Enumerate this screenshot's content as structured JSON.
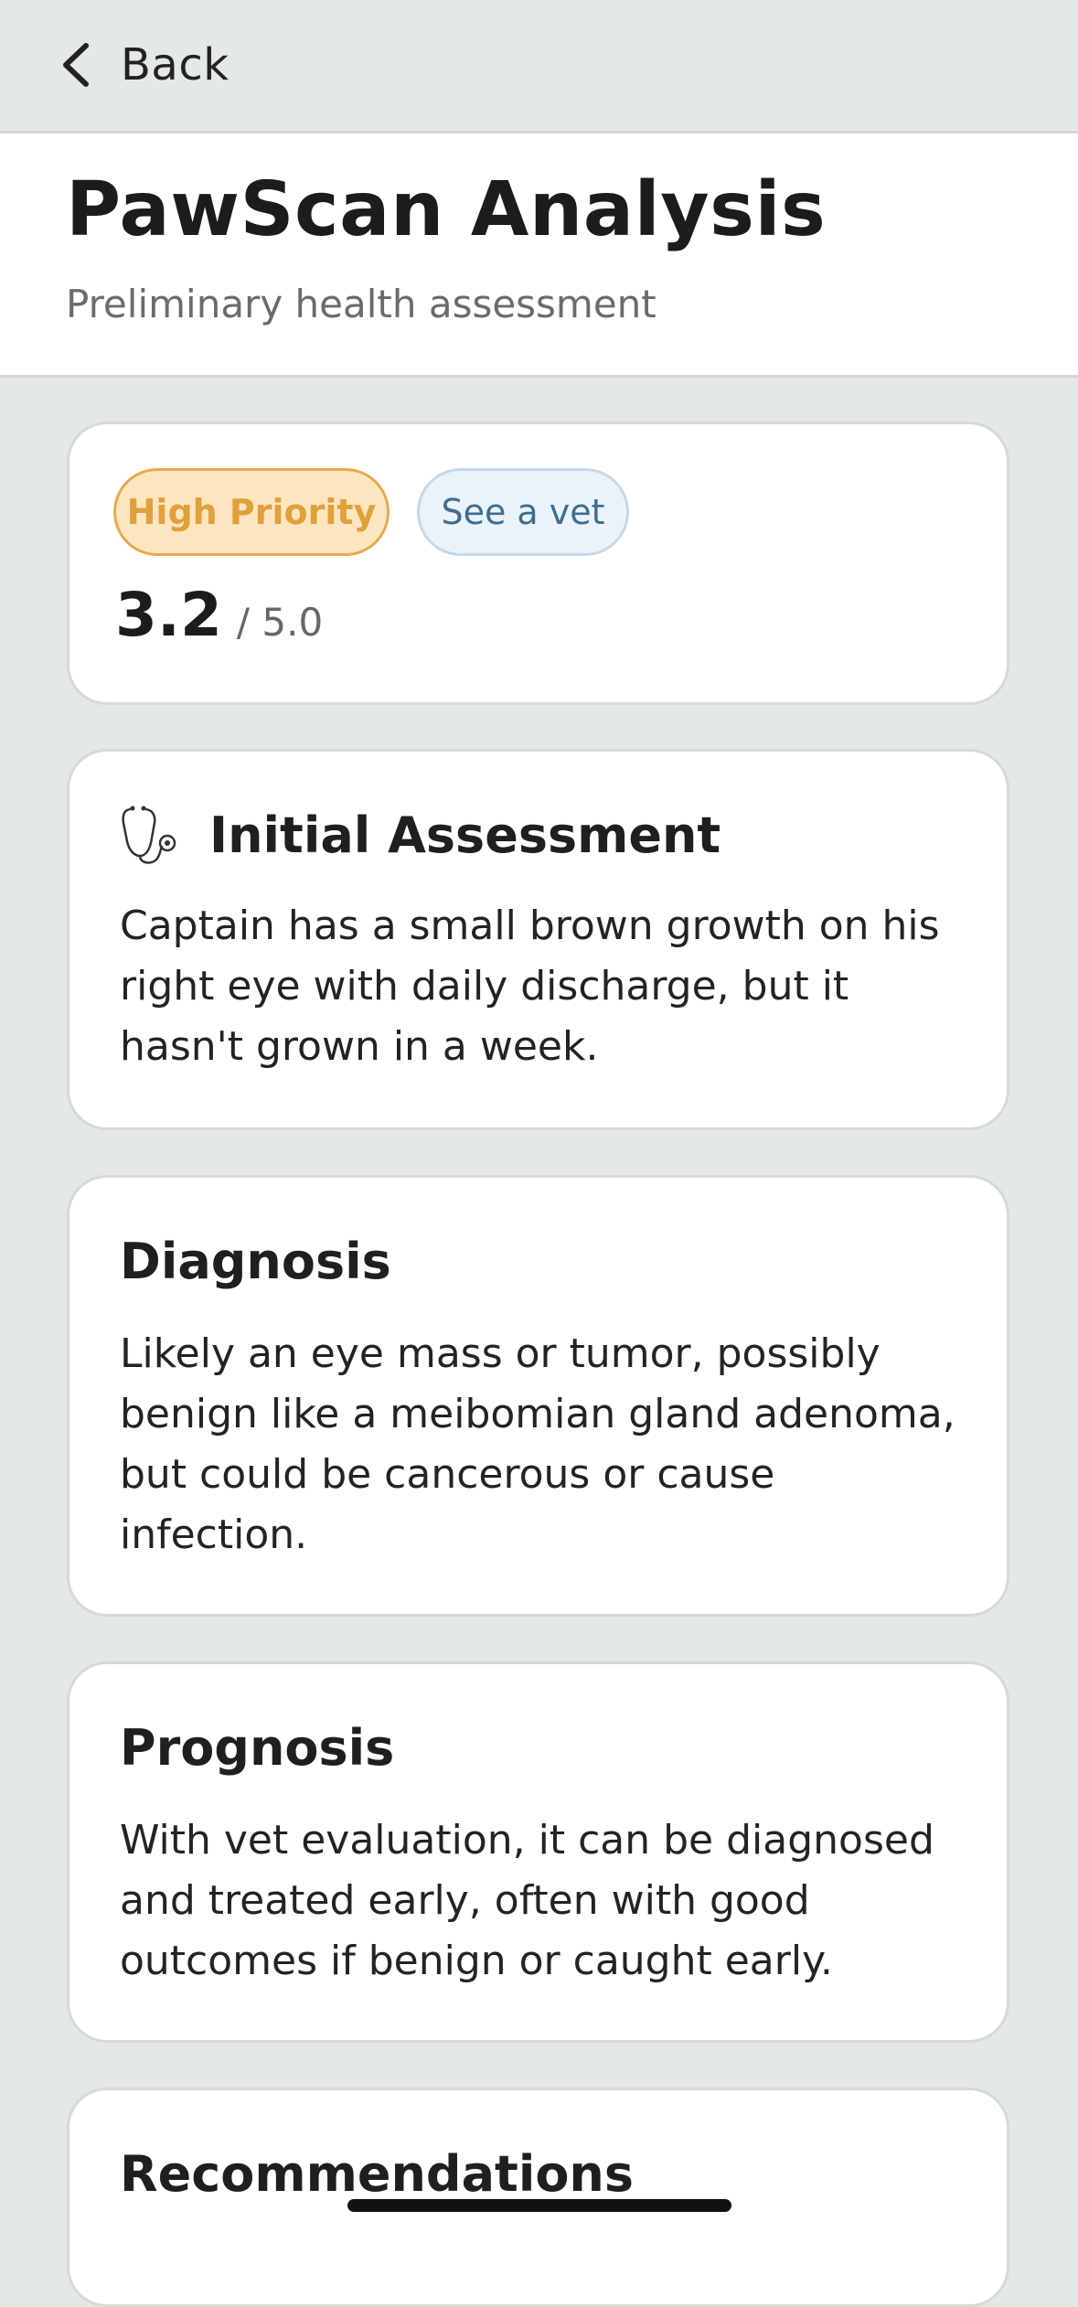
{
  "nav": {
    "back_label": "Back",
    "back_icon": "chevron-left-icon"
  },
  "header": {
    "title": "PawScan Analysis",
    "subtitle": "Preliminary health assessment"
  },
  "summary": {
    "priority_label": "High Priority",
    "action_label": "See a vet",
    "score_value": "3.2",
    "score_max": "/ 5.0",
    "priority_color": "#e0a03a"
  },
  "sections": {
    "initial": {
      "icon": "stethoscope-icon",
      "title": "Initial Assessment",
      "body": "Captain has a small brown growth on his right eye with daily discharge, but it hasn't grown in a week."
    },
    "diagnosis": {
      "title": "Diagnosis",
      "body": "Likely an eye mass or tumor, possibly benign like a meibomian gland adenoma, but could be cancerous or cause infection."
    },
    "prognosis": {
      "title": "Prognosis",
      "body": "With vet evaluation, it can be diagnosed and treated early, often with good outcomes if benign or caught early."
    },
    "recommendations": {
      "title": "Recommendations"
    }
  }
}
